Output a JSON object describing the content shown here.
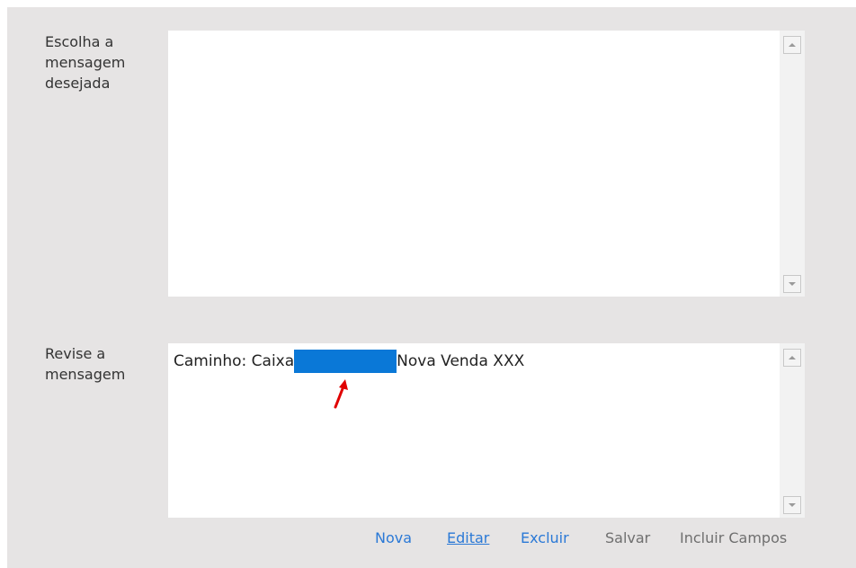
{
  "form": {
    "choose_label": "Escolha a\nmensagem\ndesejada",
    "review_label": "Revise a\nmensagem"
  },
  "choose_box": {
    "items": []
  },
  "review_box": {
    "text_before": "Caminho: Caixa",
    "text_after": "Nova Venda XXX",
    "redaction_color": "#0a78d7",
    "annotation_arrow_color": "#e00000"
  },
  "actions": {
    "nova": "Nova",
    "editar": "Editar",
    "excluir": "Excluir",
    "salvar": "Salvar",
    "incluir_campos": "Incluir Campos"
  },
  "colors": {
    "panel_bg": "#e6e4e4",
    "link_active": "#2b79d6",
    "link_disabled": "#6f6f6f"
  }
}
